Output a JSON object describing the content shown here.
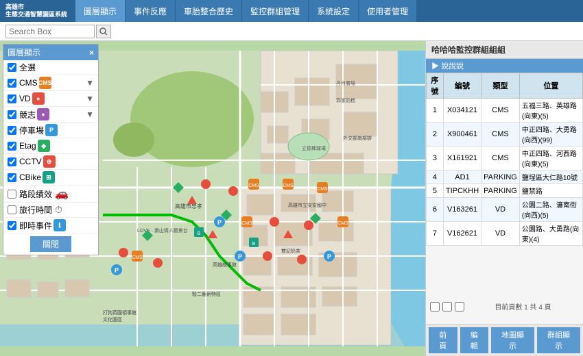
{
  "header": {
    "logo_line1": "高雄市",
    "logo_line2": "生態交通智慧園區系統",
    "tabs": [
      {
        "id": "layer",
        "label": "圖層顯示",
        "active": true
      },
      {
        "id": "events",
        "label": "事件反應"
      },
      {
        "id": "history",
        "label": "車胎整合歷史"
      },
      {
        "id": "monitor",
        "label": "監控群組管理"
      },
      {
        "id": "system",
        "label": "系統設定"
      },
      {
        "id": "users",
        "label": "使用者管理"
      }
    ]
  },
  "search": {
    "placeholder": "Search Box",
    "value": ""
  },
  "layer_panel": {
    "title": "圖層顯示",
    "close_label": "×",
    "items": [
      {
        "id": "all",
        "label": "全選",
        "checked": true,
        "icon": null,
        "icon_color": null,
        "has_arrow": false
      },
      {
        "id": "cms",
        "label": "CMS",
        "checked": true,
        "icon": "CMS",
        "icon_color": "#e67e22",
        "has_arrow": true
      },
      {
        "id": "vd",
        "label": "VD",
        "checked": true,
        "icon": "●",
        "icon_color": "#e74c3c",
        "has_arrow": true
      },
      {
        "id": "license",
        "label": "競志",
        "checked": true,
        "icon": "●",
        "icon_color": "#9b59b6",
        "has_arrow": true
      },
      {
        "id": "parking",
        "label": "停車場",
        "checked": true,
        "icon": "P",
        "icon_color": "#3498db",
        "has_arrow": false
      },
      {
        "id": "etag",
        "label": "Etag",
        "checked": true,
        "icon": "◆",
        "icon_color": "#27ae60",
        "has_arrow": false
      },
      {
        "id": "cctv",
        "label": "CCTV",
        "checked": true,
        "icon": "⊕",
        "icon_color": "#e74c3c",
        "has_arrow": false
      },
      {
        "id": "cbike",
        "label": "CBike",
        "checked": true,
        "icon": "⊞",
        "icon_color": "#16a085",
        "has_arrow": false
      },
      {
        "id": "road_perf",
        "label": "路段績效",
        "checked": false,
        "icon": null,
        "icon_color": null,
        "has_arrow": false
      },
      {
        "id": "travel",
        "label": "旅行時間",
        "checked": false,
        "icon": null,
        "icon_color": null,
        "has_arrow": false
      },
      {
        "id": "incident",
        "label": "即時事件",
        "checked": true,
        "icon": "ℹ",
        "icon_color": "#3498db",
        "has_arrow": false
      }
    ],
    "close_btn_label": "關閉"
  },
  "panel": {
    "title": "哈哈哈監控群組組組",
    "subtitle": "說說說",
    "table": {
      "headers": [
        "序號",
        "編號",
        "類型",
        "位置"
      ],
      "rows": [
        {
          "seq": "1",
          "code": "X034121",
          "type": "CMS",
          "location": "五福三路、英雄路(向東)(5)"
        },
        {
          "seq": "2",
          "code": "X900461",
          "type": "CMS",
          "location": "中正四路、大勇路(向西)(99)"
        },
        {
          "seq": "3",
          "code": "X161921",
          "type": "CMS",
          "location": "中正四路、河西路(向東)(5)"
        },
        {
          "seq": "4",
          "code": "AD1",
          "type": "PARKING",
          "location": "鹽埕區大仁路10號"
        },
        {
          "seq": "5",
          "code": "TIPCKHH",
          "type": "PARKING",
          "location": "鹽禁路"
        },
        {
          "seq": "6",
          "code": "V163261",
          "type": "VD",
          "location": "公園二路、瀋南街(向西)(5)"
        },
        {
          "seq": "7",
          "code": "V162621",
          "type": "VD",
          "location": "公園路、大勇路(向東)(4)"
        }
      ]
    },
    "pagination": {
      "info": "目前頁數 1 共 4 頁"
    },
    "buttons": [
      {
        "id": "first",
        "label": "前頁"
      },
      {
        "id": "edit",
        "label": "編輯"
      },
      {
        "id": "map_view",
        "label": "地圖顯示"
      },
      {
        "id": "group_view",
        "label": "群組顯示"
      }
    ]
  },
  "colors": {
    "header_bg": "#2a6496",
    "tab_bg": "#3a7ab0",
    "tab_active": "#5a9ad0",
    "panel_header": "#5a9ad0",
    "btn_primary": "#5a9ad0"
  }
}
